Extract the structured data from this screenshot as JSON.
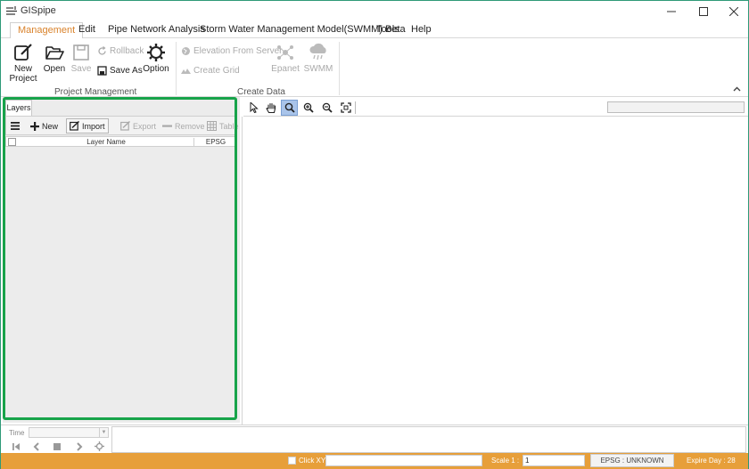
{
  "window": {
    "title": "GISpipe"
  },
  "menu": {
    "items": [
      "Management",
      "Edit",
      "Pipe Network Analysis",
      "Storm Water Management Model(SWMM) Beta",
      "Tools",
      "Help"
    ]
  },
  "ribbon": {
    "project_management": {
      "group_label": "Project Management",
      "new_project": "New\nProject",
      "open": "Open",
      "save": "Save",
      "rollback": "Rollback",
      "save_as": "Save As",
      "option": "Option"
    },
    "create_data": {
      "group_label": "Create Data",
      "elevation_from_server": "Elevation From Server",
      "create_grid": "Create Grid",
      "epanet": "Epanet",
      "swmm": "SWMM"
    }
  },
  "layers_panel": {
    "tab_label": "Layers",
    "toolbar": {
      "new": "New",
      "import": "Import",
      "export": "Export",
      "remove": "Remove",
      "table": "Table"
    },
    "columns": [
      "Layer Name",
      "EPSG"
    ]
  },
  "timebar": {
    "label": "Time"
  },
  "status": {
    "click_xy": "Click XY",
    "scale_label": "Scale  1 :",
    "scale_value": "1",
    "epsg": "EPSG : UNKNOWN",
    "expire": "Expire Day : 28"
  },
  "colors": {
    "accent": "#d9822b",
    "statusbar": "#e79f3a",
    "highlight": "#17a34a",
    "active_tool": "#a9c4ea"
  }
}
